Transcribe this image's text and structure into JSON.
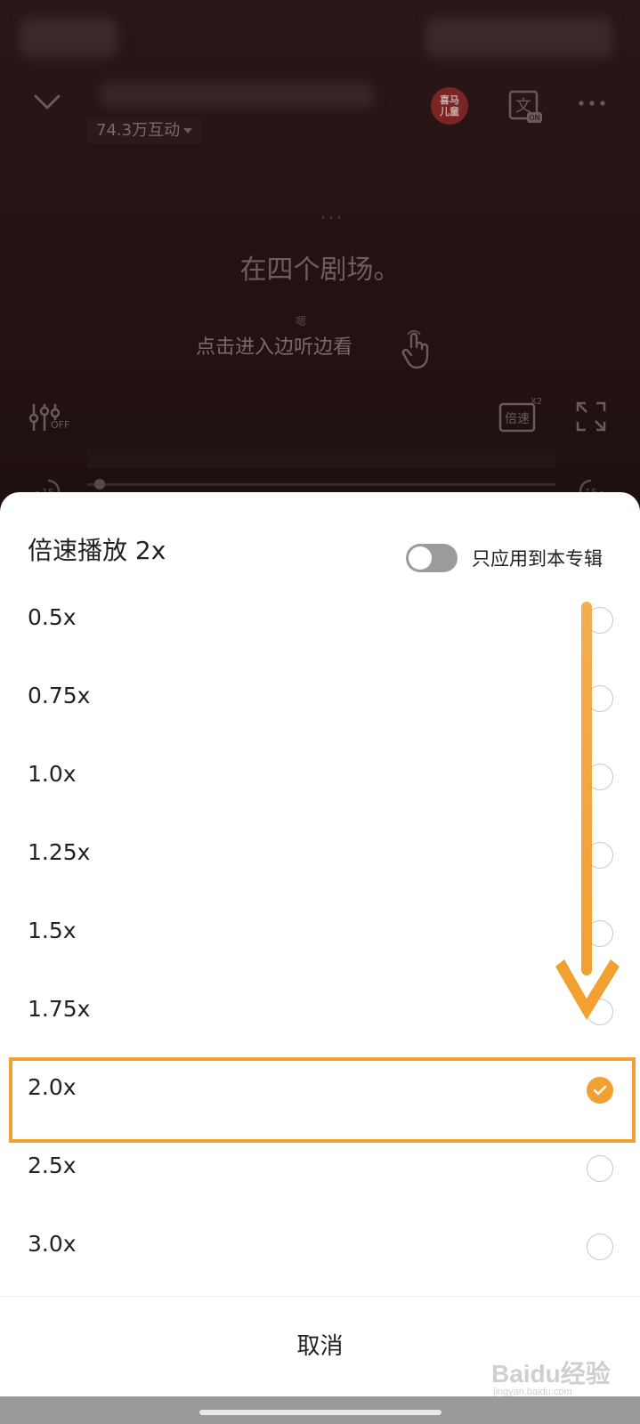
{
  "player": {
    "interaction_count": "74.3万互动",
    "badge_text": "喜马\n儿童",
    "lyric_line": "在四个剧场。",
    "lyric_small": "嗯",
    "tap_hint": "点击进入边听边看",
    "speed_icon_text": "倍速",
    "speed_icon_sup": "X2",
    "eq_off_text": "OFF",
    "wen_on_text": "ON",
    "skip_value": "15"
  },
  "sheet": {
    "title": "倍速播放 2x",
    "toggle_label": "只应用到本专辑",
    "toggle_on": false,
    "options": [
      {
        "label": "0.5x",
        "selected": false
      },
      {
        "label": "0.75x",
        "selected": false
      },
      {
        "label": "1.0x",
        "selected": false
      },
      {
        "label": "1.25x",
        "selected": false
      },
      {
        "label": "1.5x",
        "selected": false
      },
      {
        "label": "1.75x",
        "selected": false
      },
      {
        "label": "2.0x",
        "selected": true
      },
      {
        "label": "2.5x",
        "selected": false
      },
      {
        "label": "3.0x",
        "selected": false
      }
    ],
    "cancel_label": "取消"
  },
  "colors": {
    "accent": "#f2a032",
    "sheet_bg": "#ffffff",
    "player_bg": "#231212"
  },
  "watermark": {
    "main": "Baidu经验",
    "sub": "jingyan.baidu.com"
  }
}
